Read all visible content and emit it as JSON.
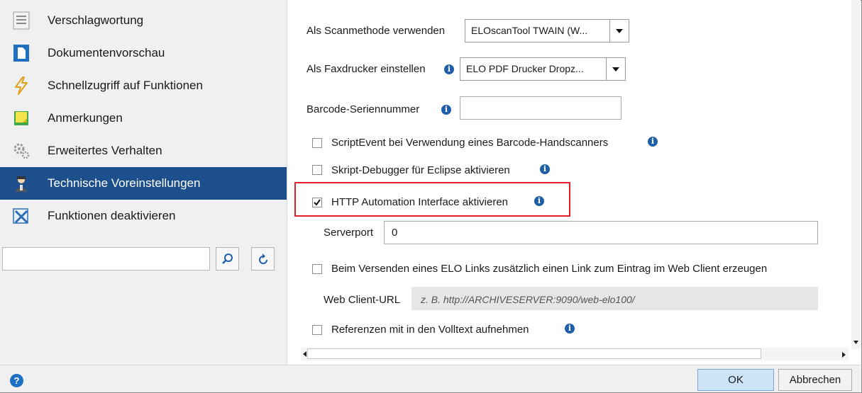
{
  "sidebar": {
    "items": [
      {
        "label": "Verschlagwortung",
        "icon": "keywording-icon"
      },
      {
        "label": "Dokumentenvorschau",
        "icon": "document-preview-icon"
      },
      {
        "label": "Schnellzugriff auf Funktionen",
        "icon": "lightning-icon"
      },
      {
        "label": "Anmerkungen",
        "icon": "sticky-note-icon"
      },
      {
        "label": "Erweitertes Verhalten",
        "icon": "gears-icon"
      },
      {
        "label": "Technische Voreinstellungen",
        "icon": "technician-icon",
        "active": true
      },
      {
        "label": "Funktionen deaktivieren",
        "icon": "disable-functions-icon"
      }
    ],
    "search_value": ""
  },
  "settings": {
    "scan_method_label": "Als Scanmethode verwenden",
    "scan_method_value": "ELOscanTool TWAIN (W...",
    "fax_printer_label": "Als Faxdrucker einstellen",
    "fax_printer_value": "ELO PDF Drucker Dropz...",
    "barcode_serial_label": "Barcode-Seriennummer",
    "barcode_serial_value": "",
    "scriptevent_label": "ScriptEvent bei Verwendung eines Barcode-Handscanners",
    "scriptevent_checked": false,
    "debugger_label": "Skript-Debugger für Eclipse aktivieren",
    "debugger_checked": false,
    "http_label": "HTTP Automation Interface aktivieren",
    "http_checked": true,
    "serverport_label": "Serverport",
    "serverport_value": "0",
    "elo_link_label": "Beim Versenden eines ELO Links zusätzlich einen Link zum Eintrag im Web Client erzeugen",
    "elo_link_checked": false,
    "webclient_label": "Web Client-URL",
    "webclient_placeholder": "z. B. http://ARCHIVESERVER:9090/web-elo100/",
    "references_label": "Referenzen mit in den Volltext aufnehmen",
    "references_checked": false,
    "info_glyph": "i"
  },
  "footer": {
    "help_glyph": "?",
    "ok_label": "OK",
    "cancel_label": "Abbrechen"
  },
  "colors": {
    "active_item": "#1d4f8c",
    "highlight_border": "#e0202c",
    "info_icon": "#1f5fa8",
    "ok_button": "#cde3f7"
  }
}
